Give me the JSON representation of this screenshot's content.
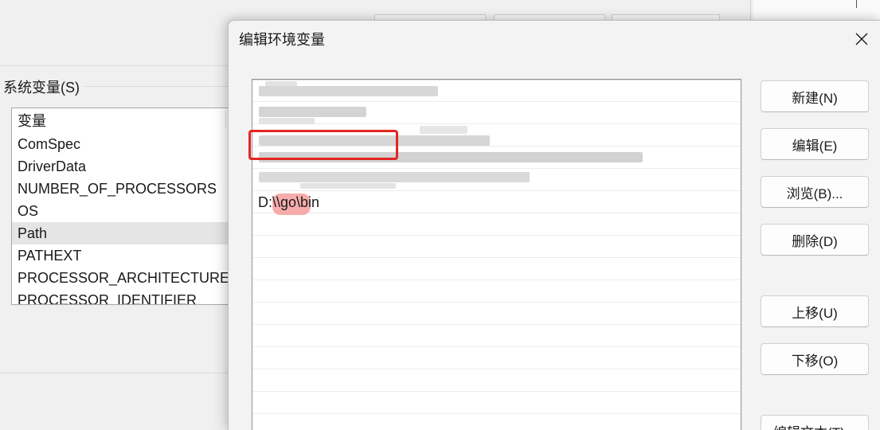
{
  "background_window": {
    "group_label": "系统变量(S)",
    "variables_header": "变量",
    "variables": [
      "ComSpec",
      "DriverData",
      "NUMBER_OF_PROCESSORS",
      "OS",
      "Path",
      "PATHEXT",
      "PROCESSOR_ARCHITECTURE",
      "PROCESSOR_IDENTIFIER"
    ],
    "selected_variable": "Path"
  },
  "dialog": {
    "title": "编辑环境变量",
    "path_entries": [
      {
        "blurred": true
      },
      {
        "blurred": true
      },
      {
        "blurred": true
      },
      {
        "blurred": true
      },
      {
        "blurred": true
      },
      {
        "text": "D:\\\\go\\bin",
        "highlighted": true
      }
    ],
    "buttons": {
      "new": "新建(N)",
      "edit": "编辑(E)",
      "browse": "浏览(B)...",
      "delete": "删除(D)",
      "move_up": "上移(U)",
      "move_down": "下移(O)",
      "edit_text": "编辑文本(T)..."
    }
  },
  "colors": {
    "highlight_box": "#e52421",
    "selected_row": "#e5e5e5"
  },
  "icons": {
    "close": "close-icon"
  }
}
